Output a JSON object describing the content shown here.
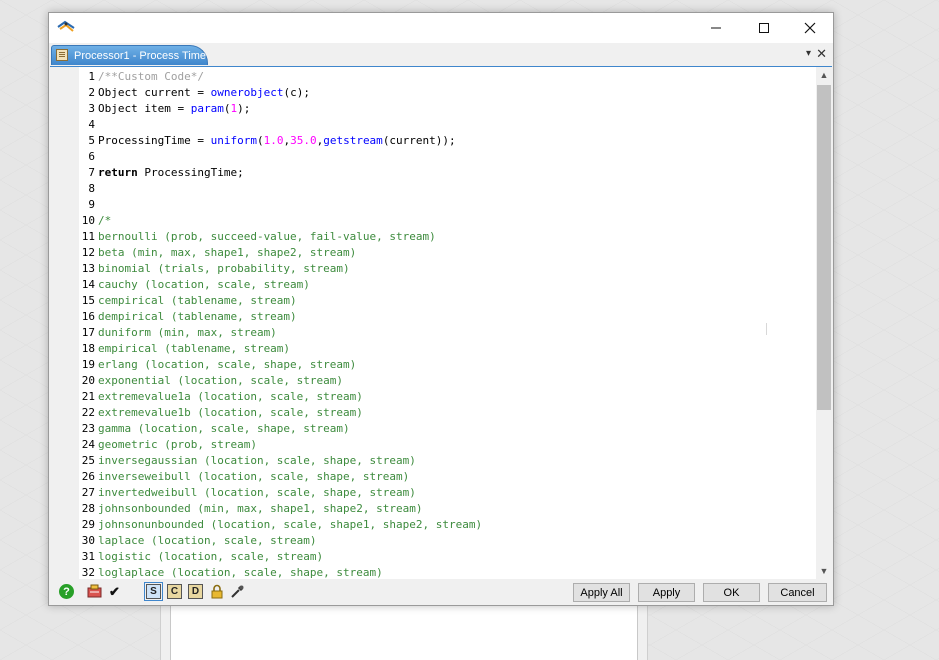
{
  "window": {
    "tab_title": "Processor1 - Process Time",
    "controls": {
      "minimize": "—",
      "maximize": "☐",
      "close": "✕"
    },
    "tab_menu_glyph": "▾",
    "tab_close_glyph": "✕"
  },
  "code_lines": [
    {
      "n": "1",
      "segs": [
        {
          "c": "cmg",
          "t": "/**Custom Code*/"
        }
      ]
    },
    {
      "n": "2",
      "segs": [
        {
          "c": "",
          "t": "Object current = "
        },
        {
          "c": "fn",
          "t": "ownerobject"
        },
        {
          "c": "",
          "t": "(c);"
        }
      ]
    },
    {
      "n": "3",
      "segs": [
        {
          "c": "",
          "t": "Object item = "
        },
        {
          "c": "fn",
          "t": "param"
        },
        {
          "c": "",
          "t": "("
        },
        {
          "c": "num",
          "t": "1"
        },
        {
          "c": "",
          "t": ");"
        }
      ]
    },
    {
      "n": "4",
      "segs": []
    },
    {
      "n": "5",
      "segs": [
        {
          "c": "",
          "t": "ProcessingTime = "
        },
        {
          "c": "fn",
          "t": "uniform"
        },
        {
          "c": "",
          "t": "("
        },
        {
          "c": "num",
          "t": "1.0"
        },
        {
          "c": "",
          "t": ","
        },
        {
          "c": "num",
          "t": "35.0"
        },
        {
          "c": "",
          "t": ","
        },
        {
          "c": "fn",
          "t": "getstream"
        },
        {
          "c": "",
          "t": "(current));"
        }
      ]
    },
    {
      "n": "6",
      "segs": []
    },
    {
      "n": "7",
      "segs": [
        {
          "c": "kw",
          "t": "return"
        },
        {
          "c": "",
          "t": " ProcessingTime;"
        }
      ]
    },
    {
      "n": "8",
      "segs": []
    },
    {
      "n": "9",
      "segs": []
    },
    {
      "n": "10",
      "segs": [
        {
          "c": "cm",
          "t": "/*"
        }
      ]
    },
    {
      "n": "11",
      "segs": [
        {
          "c": "cm",
          "t": "bernoulli (prob, succeed-value, fail-value, stream)"
        }
      ]
    },
    {
      "n": "12",
      "segs": [
        {
          "c": "cm",
          "t": "beta (min, max, shape1, shape2, stream)"
        }
      ]
    },
    {
      "n": "13",
      "segs": [
        {
          "c": "cm",
          "t": "binomial (trials, probability, stream)"
        }
      ]
    },
    {
      "n": "14",
      "segs": [
        {
          "c": "cm",
          "t": "cauchy (location, scale, stream)"
        }
      ]
    },
    {
      "n": "15",
      "segs": [
        {
          "c": "cm",
          "t": "cempirical (tablename, stream)"
        }
      ]
    },
    {
      "n": "16",
      "segs": [
        {
          "c": "cm",
          "t": "dempirical (tablename, stream)"
        }
      ]
    },
    {
      "n": "17",
      "segs": [
        {
          "c": "cm",
          "t": "duniform (min, max, stream)"
        }
      ]
    },
    {
      "n": "18",
      "segs": [
        {
          "c": "cm",
          "t": "empirical (tablename, stream)"
        }
      ]
    },
    {
      "n": "19",
      "segs": [
        {
          "c": "cm",
          "t": "erlang (location, scale, shape, stream)"
        }
      ]
    },
    {
      "n": "20",
      "segs": [
        {
          "c": "cm",
          "t": "exponential (location, scale, stream)"
        }
      ]
    },
    {
      "n": "21",
      "segs": [
        {
          "c": "cm",
          "t": "extremevalue1a (location, scale, stream)"
        }
      ]
    },
    {
      "n": "22",
      "segs": [
        {
          "c": "cm",
          "t": "extremevalue1b (location, scale, stream)"
        }
      ]
    },
    {
      "n": "23",
      "segs": [
        {
          "c": "cm",
          "t": "gamma (location, scale, shape, stream)"
        }
      ]
    },
    {
      "n": "24",
      "segs": [
        {
          "c": "cm",
          "t": "geometric (prob, stream)"
        }
      ]
    },
    {
      "n": "25",
      "segs": [
        {
          "c": "cm",
          "t": "inversegaussian (location, scale, shape, stream)"
        }
      ]
    },
    {
      "n": "26",
      "segs": [
        {
          "c": "cm",
          "t": "inverseweibull (location, scale, shape, stream)"
        }
      ]
    },
    {
      "n": "27",
      "segs": [
        {
          "c": "cm",
          "t": "invertedweibull (location, scale, shape, stream)"
        }
      ]
    },
    {
      "n": "28",
      "segs": [
        {
          "c": "cm",
          "t": "johnsonbounded (min, max, shape1, shape2, stream)"
        }
      ]
    },
    {
      "n": "29",
      "segs": [
        {
          "c": "cm",
          "t": "johnsonunbounded (location, scale, shape1, shape2, stream)"
        }
      ]
    },
    {
      "n": "30",
      "segs": [
        {
          "c": "cm",
          "t": "laplace (location, scale, stream)"
        }
      ]
    },
    {
      "n": "31",
      "segs": [
        {
          "c": "cm",
          "t": "logistic (location, scale, stream)"
        }
      ]
    },
    {
      "n": "32",
      "segs": [
        {
          "c": "cm",
          "t": "loglaplace (location, scale, shape, stream)"
        }
      ]
    }
  ],
  "toolbar": {
    "help_glyph": "?",
    "checkmark_glyph": "✔",
    "s_label": "S",
    "c_label": "C",
    "d_label": "D",
    "lock_glyph": "🔒"
  },
  "buttons": {
    "apply_all": "Apply All",
    "apply": "Apply",
    "ok": "OK",
    "cancel": "Cancel"
  },
  "colors": {
    "tab_blue": "#3f86cc",
    "keyword_blue": "#0000ff",
    "number_magenta": "#ff00ff",
    "comment_green": "#3d8b3d"
  }
}
